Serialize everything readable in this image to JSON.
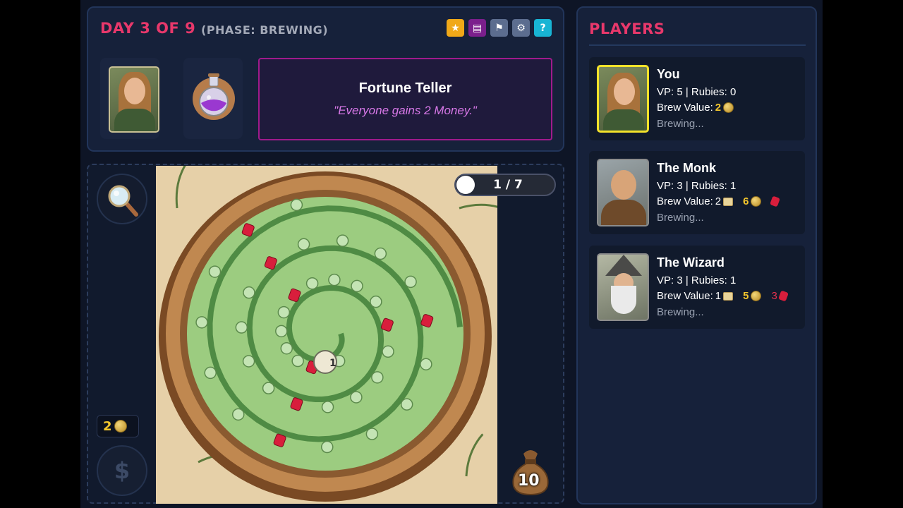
{
  "header": {
    "day_label": "DAY 3 OF 9",
    "phase_label": "(PHASE: BREWING)",
    "icon_buttons": [
      {
        "icon": "star-icon",
        "glyph": "★"
      },
      {
        "icon": "book-icon",
        "glyph": "▤"
      },
      {
        "icon": "flag-icon",
        "glyph": "⚑"
      },
      {
        "icon": "gear-icon",
        "glyph": "⚙"
      },
      {
        "icon": "help-icon",
        "glyph": "?"
      }
    ]
  },
  "event_card": {
    "title": "Fortune Teller",
    "description": "\"Everyone gains 2 Money.\""
  },
  "board": {
    "progress": "1 / 7",
    "money": "2",
    "dollar_symbol": "$",
    "bag_count": "10",
    "center_token": "1"
  },
  "players_panel": {
    "title": "PLAYERS",
    "players": [
      {
        "name": "You",
        "stats": "VP: 5 | Rubies: 0",
        "brew_label": "Brew Value:",
        "brew_scroll": "2",
        "brew_coins": "",
        "brew_rubies": "",
        "status": "Brewing...",
        "active": true
      },
      {
        "name": "The Monk",
        "stats": "VP: 3 | Rubies: 1",
        "brew_label": "Brew Value:",
        "brew_scroll": "2",
        "brew_coins": "6",
        "brew_rubies": "",
        "status": "Brewing...",
        "active": false
      },
      {
        "name": "The Wizard",
        "stats": "VP: 3 | Rubies: 1",
        "brew_label": "Brew Value:",
        "brew_scroll": "1",
        "brew_coins": "5",
        "brew_rubies": "3",
        "status": "Brewing...",
        "active": false
      }
    ]
  },
  "colors": {
    "accent": "#e8386b",
    "gold": "#f3c62c",
    "panel": "#16213a",
    "card_border": "#a01a8c",
    "card_desc": "#d878e8"
  }
}
